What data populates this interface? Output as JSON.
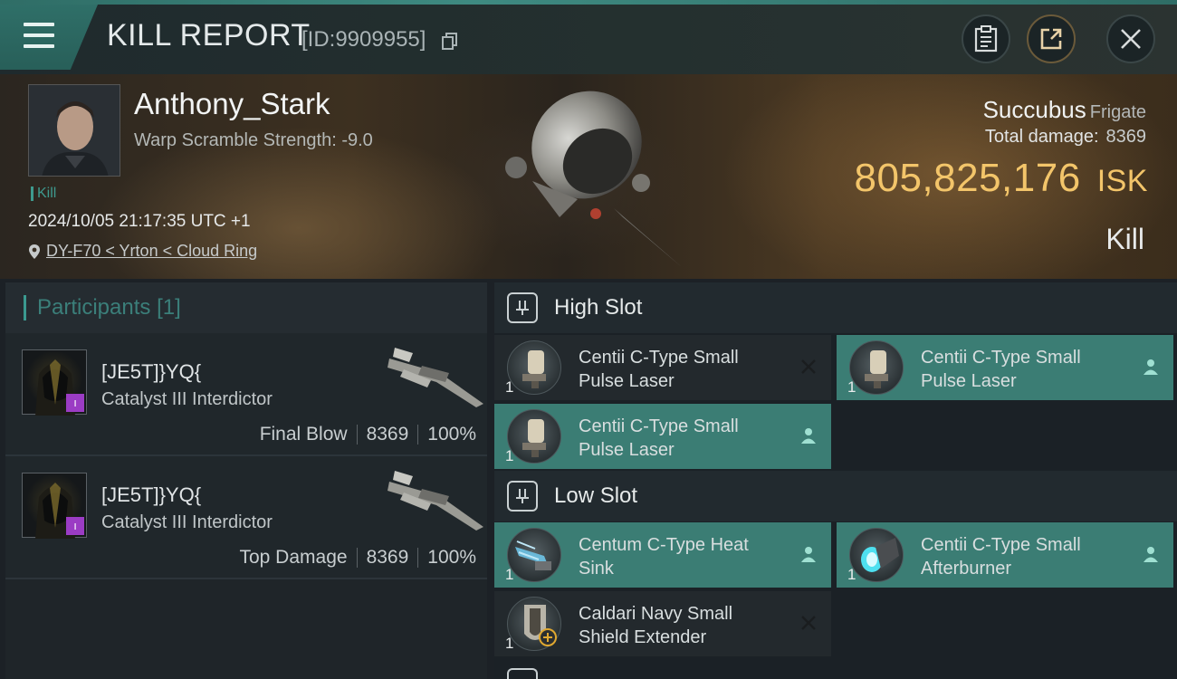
{
  "header": {
    "title": "KILL REPORT",
    "report_id": "[ID:9909955]"
  },
  "victim": {
    "name": "Anthony_Stark",
    "warp_scramble": "Warp Scramble Strength: -9.0",
    "kill_tag": "Kill",
    "datetime": "2024/10/05 21:17:35 UTC +1",
    "location": "DY-F70 < Yrton < Cloud Ring",
    "ship_name": "Succubus",
    "ship_class": "Frigate",
    "total_damage_label": "Total damage:",
    "total_damage": "8369",
    "isk_value": "805,825,176",
    "isk_unit": "ISK",
    "result": "Kill"
  },
  "participants": {
    "title": "Participants",
    "count": "[1]",
    "items": [
      {
        "name": "[JE5T]}YQ{",
        "ship": "Catalyst III Interdictor",
        "role": "Final Blow",
        "damage": "8369",
        "percent": "100%"
      },
      {
        "name": "[JE5T]}YQ{",
        "ship": "Catalyst III Interdictor",
        "role": "Top Damage",
        "damage": "8369",
        "percent": "100%"
      }
    ]
  },
  "fitting": {
    "high_slot": {
      "label": "High Slot",
      "modules": [
        {
          "name": "Centii C-Type Small Pulse Laser",
          "qty": "1",
          "status": "destroyed"
        },
        {
          "name": "Centii C-Type Small Pulse Laser",
          "qty": "1",
          "status": "dropped"
        },
        {
          "name": "Centii C-Type Small Pulse Laser",
          "qty": "1",
          "status": "dropped"
        }
      ]
    },
    "low_slot": {
      "label": "Low Slot",
      "modules": [
        {
          "name": "Centum C-Type Heat Sink",
          "qty": "1",
          "status": "dropped"
        },
        {
          "name": "Centii C-Type Small Afterburner",
          "qty": "1",
          "status": "dropped"
        },
        {
          "name": "Caldari Navy Small Shield Extender",
          "qty": "1",
          "status": "destroyed"
        }
      ]
    }
  },
  "icons": {
    "menu": "menu-icon",
    "copy": "copy-icon",
    "clipboard": "clipboard-icon",
    "share": "share-icon",
    "close": "close-icon",
    "location": "location-pin-icon",
    "slot": "slot-icon",
    "pilot": "pilot-icon",
    "destroyed": "x-icon"
  },
  "colors": {
    "accent": "#3b7d74",
    "isk": "#f3c56a",
    "badge": "#9b3cc4"
  }
}
